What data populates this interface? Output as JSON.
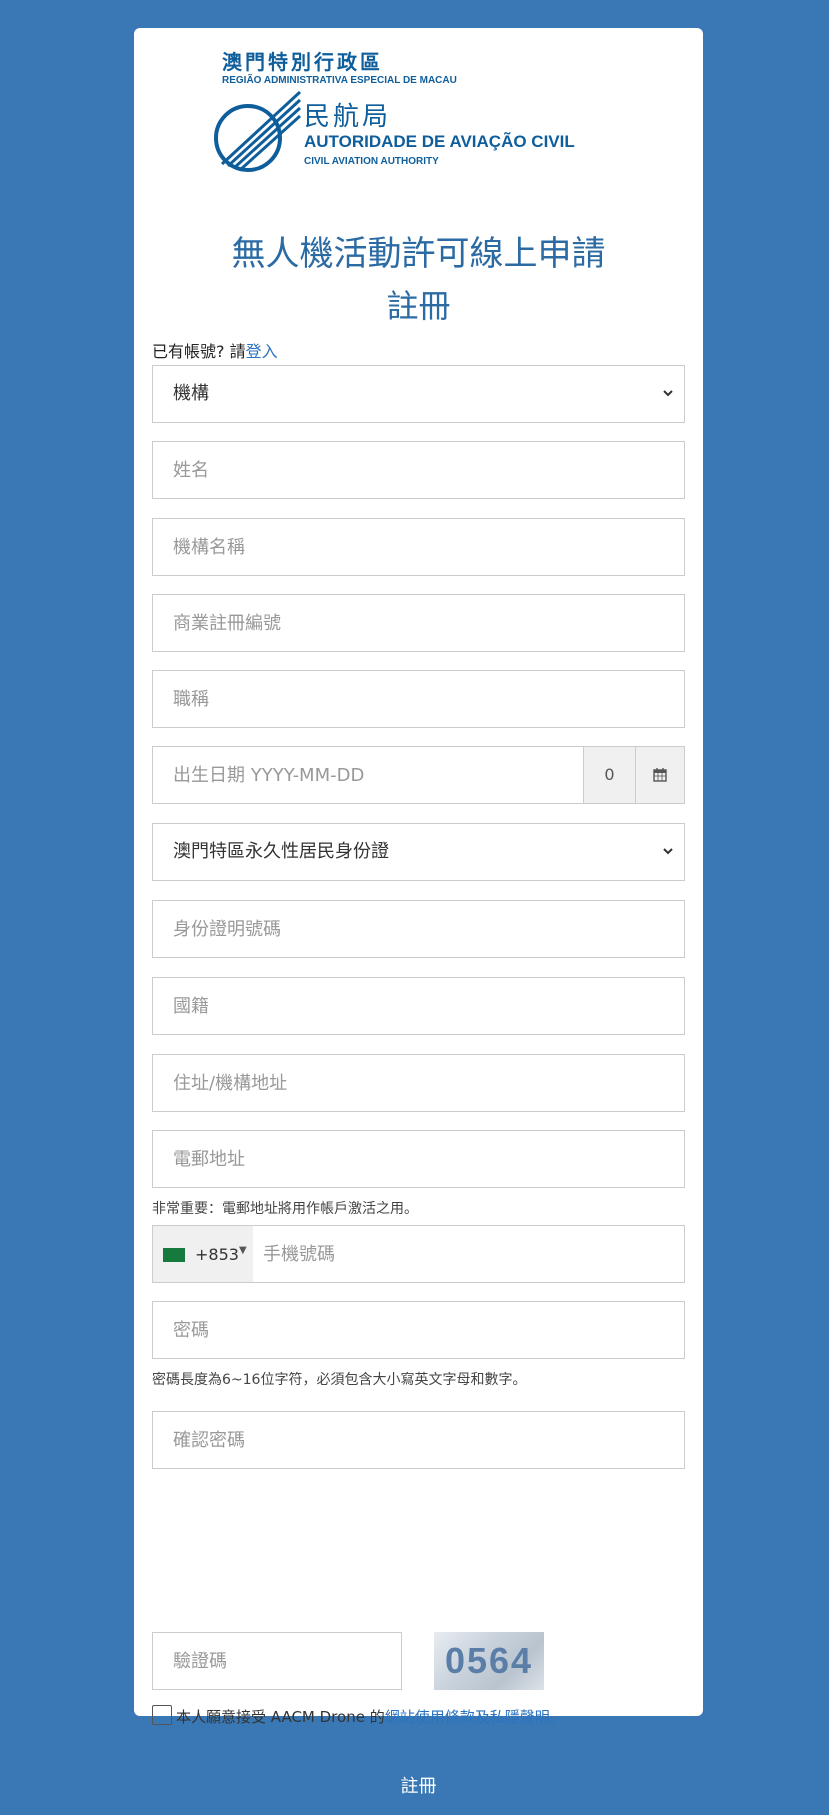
{
  "header": {
    "org_zh": "澳門特別行政區",
    "org_pt": "REGIÃO ADMINISTRATIVA ESPECIAL DE MACAU",
    "dept_zh": "民航局",
    "dept_pt": "AUTORIDADE DE AVIAÇÃO CIVIL",
    "dept_en": "CIVIL AVIATION AUTHORITY"
  },
  "title": "無人機活動許可線上申請",
  "subtitle": "註冊",
  "login_prompt": "已有帳號? 請",
  "login_link": "登入",
  "form": {
    "applicant_type": "機構",
    "name_placeholder": "姓名",
    "org_name_placeholder": "機構名稱",
    "biz_reg_placeholder": "商業註冊編號",
    "job_title_placeholder": "職稱",
    "dob_placeholder": "出生日期 YYYY-MM-DD",
    "dob_age": "0",
    "id_type": "澳門特區永久性居民身份證",
    "id_number_placeholder": "身份證明號碼",
    "nationality_placeholder": "國籍",
    "address_placeholder": "住址/機構地址",
    "email_placeholder": "電郵地址",
    "email_hint": "非常重要：電郵地址將用作帳戶激活之用。",
    "phone_prefix": "+853",
    "phone_placeholder": "手機號碼",
    "password_placeholder": "密碼",
    "password_hint": "密碼長度為6~16位字符，必須包含大小寫英文字母和數字。",
    "confirm_password_placeholder": "確認密碼",
    "captcha_placeholder": "驗證碼",
    "captcha_text": "0564"
  },
  "agreement": {
    "prefix": "本人願意接受 AACM Drone 的",
    "link": "網站使用條款及私隱聲明。"
  },
  "submit_label": "註冊",
  "colors": {
    "background": "#3a78b5",
    "accent": "#2a73c0"
  }
}
